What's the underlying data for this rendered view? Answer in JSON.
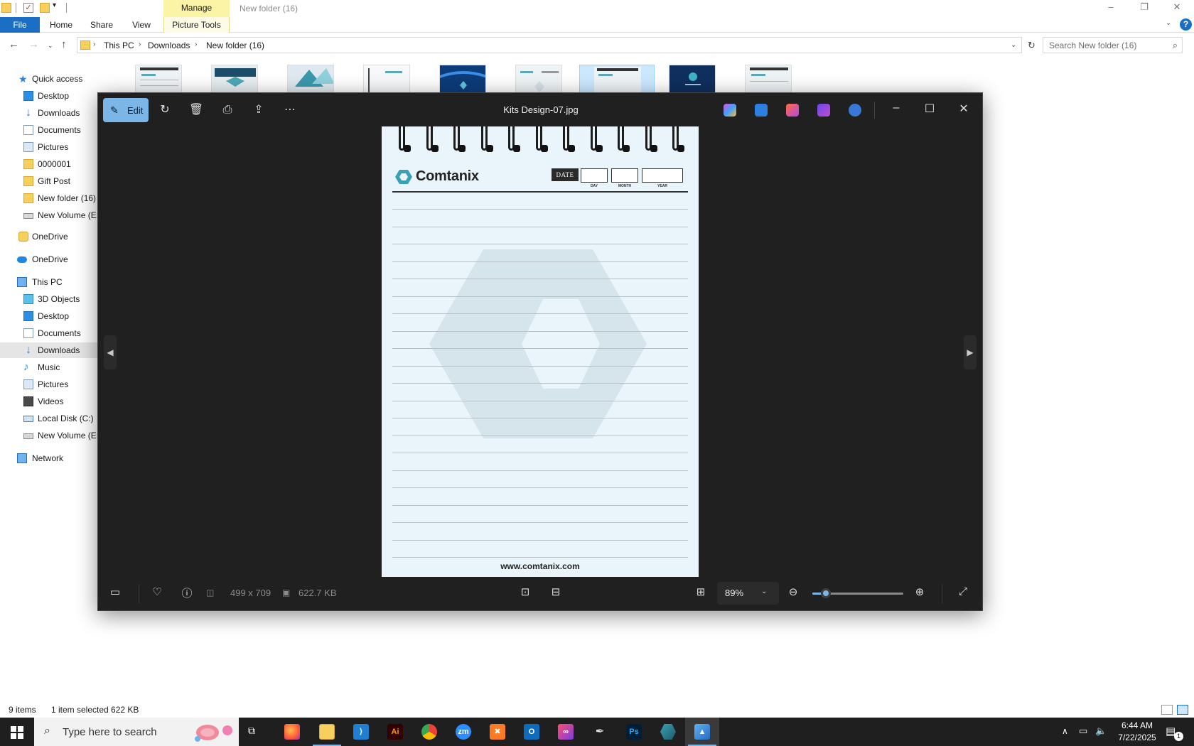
{
  "explorer": {
    "title": "New folder (16)",
    "manage_label": "Manage",
    "ribbon_tabs": {
      "file": "File",
      "home": "Home",
      "share": "Share",
      "view": "View",
      "picture_tools": "Picture Tools"
    },
    "breadcrumb": [
      "This PC",
      "Downloads",
      "New folder (16)"
    ],
    "search_placeholder": "Search New folder (16)",
    "nav": {
      "quick_access": "Quick access",
      "qa_items": [
        "Desktop",
        "Downloads",
        "Documents",
        "Pictures",
        "0000001",
        "Gift Post",
        "New folder (16)",
        "New Volume (E:)"
      ],
      "onedrive_personal": "OneDrive",
      "onedrive": "OneDrive",
      "this_pc": "This PC",
      "pc_items": [
        "3D Objects",
        "Desktop",
        "Documents",
        "Downloads",
        "Music",
        "Pictures",
        "Videos",
        "Local Disk (C:)",
        "New Volume (E:)"
      ],
      "network": "Network"
    },
    "status": {
      "count": "9 items",
      "selected": "1 item selected  622 KB"
    }
  },
  "photos": {
    "edit_label": "Edit",
    "title": "Kits Design-07.jpg",
    "dimensions": "499 x 709",
    "filesize": "622.7 KB",
    "zoom": "89%",
    "zoom_level": 0.15
  },
  "note": {
    "brand": "Comtanix",
    "date_label": "DATE",
    "date_fields": [
      "DAY",
      "MONTH",
      "YEAR"
    ],
    "website": "www.comtanix.com"
  },
  "taskbar": {
    "search_placeholder": "Type here to search",
    "apps": [
      "Firefox",
      "File Explorer",
      "Visual Studio Code",
      "Illustrator",
      "Chrome",
      "Zoom",
      "XAMPP",
      "Outlook",
      "Creative Cloud",
      "Pen tool",
      "Photoshop",
      "Comtanix app",
      "Photos"
    ],
    "app_glyphs": {
      "illustrator": "Ai",
      "zoom": "zm",
      "photoshop": "Ps",
      "outlook": "O"
    },
    "time": "6:44 AM",
    "date": "7/22/2025",
    "notifications": "1"
  },
  "colors": {
    "accent": "#7cb6e6",
    "file_tab": "#1a6fc4",
    "manage_tab": "#fbf3a5",
    "photos_bg": "#202020"
  }
}
